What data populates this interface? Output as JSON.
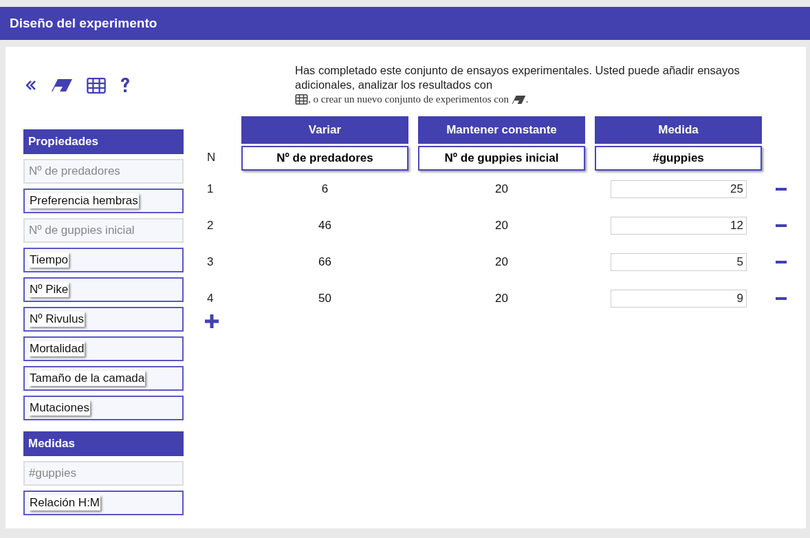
{
  "window": {
    "title": "Diseño del experimento"
  },
  "instructions": {
    "text_1": "Has completado este conjunto de ensayos experimentales. Usted puede añadir ensayos adicionales, analizar los resultados con",
    "text_2": ", o crear un nuevo conjunto de experimentos con",
    "text_3": "."
  },
  "sidebar": [
    {
      "title": "Propiedades",
      "items": [
        {
          "label": "Nº de predadores",
          "disabled": true
        },
        {
          "label": "Preferencia hembras",
          "disabled": false
        },
        {
          "label": "Nº de guppies inicial",
          "disabled": true
        },
        {
          "label": "Tiempo",
          "disabled": false
        },
        {
          "label": "Nº Pike",
          "disabled": false
        },
        {
          "label": "Nº Rivulus",
          "disabled": false
        },
        {
          "label": "Mortalidad",
          "disabled": false
        },
        {
          "label": "Tamaño de la camada",
          "disabled": false
        },
        {
          "label": "Mutaciones",
          "disabled": false
        }
      ]
    },
    {
      "title": "Medidas",
      "items": [
        {
          "label": "#guppies",
          "disabled": true
        },
        {
          "label": "Relación H:M",
          "disabled": false
        }
      ]
    }
  ],
  "table": {
    "n_header": "N",
    "columns": [
      {
        "group": "Variar",
        "variable": "Nº de predadores"
      },
      {
        "group": "Mantener constante",
        "variable": "Nº de guppies inicial"
      },
      {
        "group": "Medida",
        "variable": "#guppies"
      }
    ],
    "rows": [
      {
        "n": "1",
        "varied": "6",
        "constant": "20",
        "measured": "25"
      },
      {
        "n": "2",
        "varied": "46",
        "constant": "20",
        "measured": "12"
      },
      {
        "n": "3",
        "varied": "66",
        "constant": "20",
        "measured": "5"
      },
      {
        "n": "4",
        "varied": "50",
        "constant": "20",
        "measured": "9"
      }
    ]
  }
}
